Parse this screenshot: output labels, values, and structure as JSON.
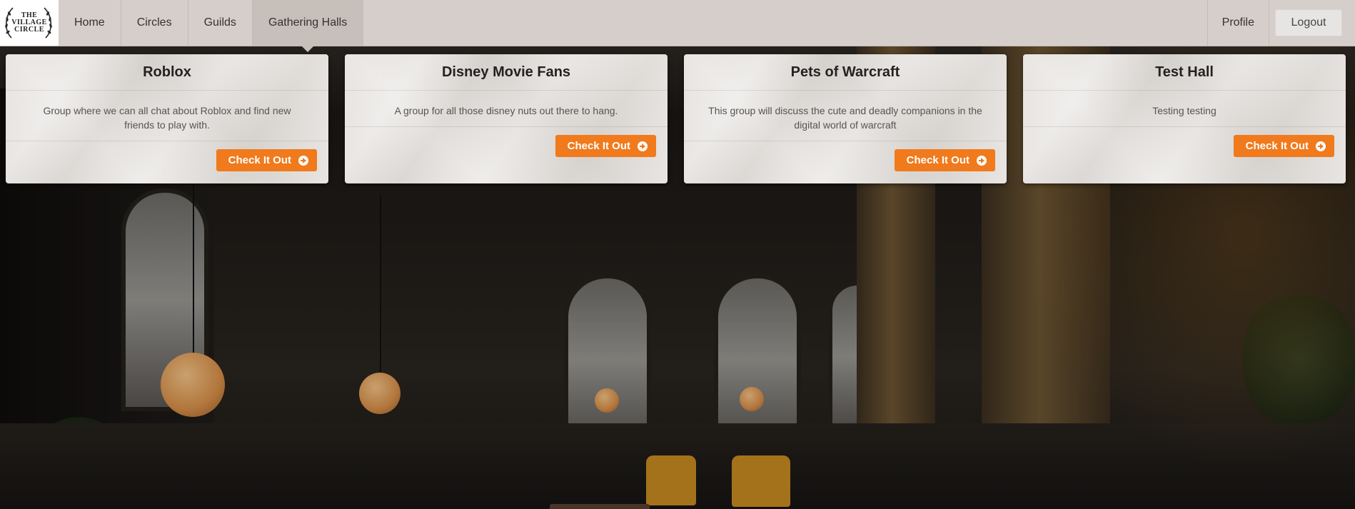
{
  "logo": {
    "line1": "THE",
    "line2": "VILLAGE",
    "line3": "CIRCLE"
  },
  "nav": {
    "items": [
      {
        "label": "Home"
      },
      {
        "label": "Circles"
      },
      {
        "label": "Guilds"
      },
      {
        "label": "Gathering Halls",
        "active": true
      }
    ],
    "profile": "Profile",
    "logout": "Logout"
  },
  "cards": [
    {
      "title": "Roblox",
      "description": "Group where we can all chat about Roblox and find new friends to play with.",
      "button": "Check It Out"
    },
    {
      "title": "Disney Movie Fans",
      "description": "A group for all those disney nuts out there to hang.",
      "button": "Check It Out"
    },
    {
      "title": "Pets of Warcraft",
      "description": "This group will discuss the cute and deadly companions in the digital world of warcraft",
      "button": "Check It Out"
    },
    {
      "title": "Test Hall",
      "description": "Testing testing",
      "button": "Check It Out"
    }
  ],
  "colors": {
    "navbar": "#d6ceca",
    "active_tab": "#c7bfba",
    "accent_button": "#f07a1c"
  },
  "icons": {
    "card_button": "arrow-circle-right-icon"
  }
}
